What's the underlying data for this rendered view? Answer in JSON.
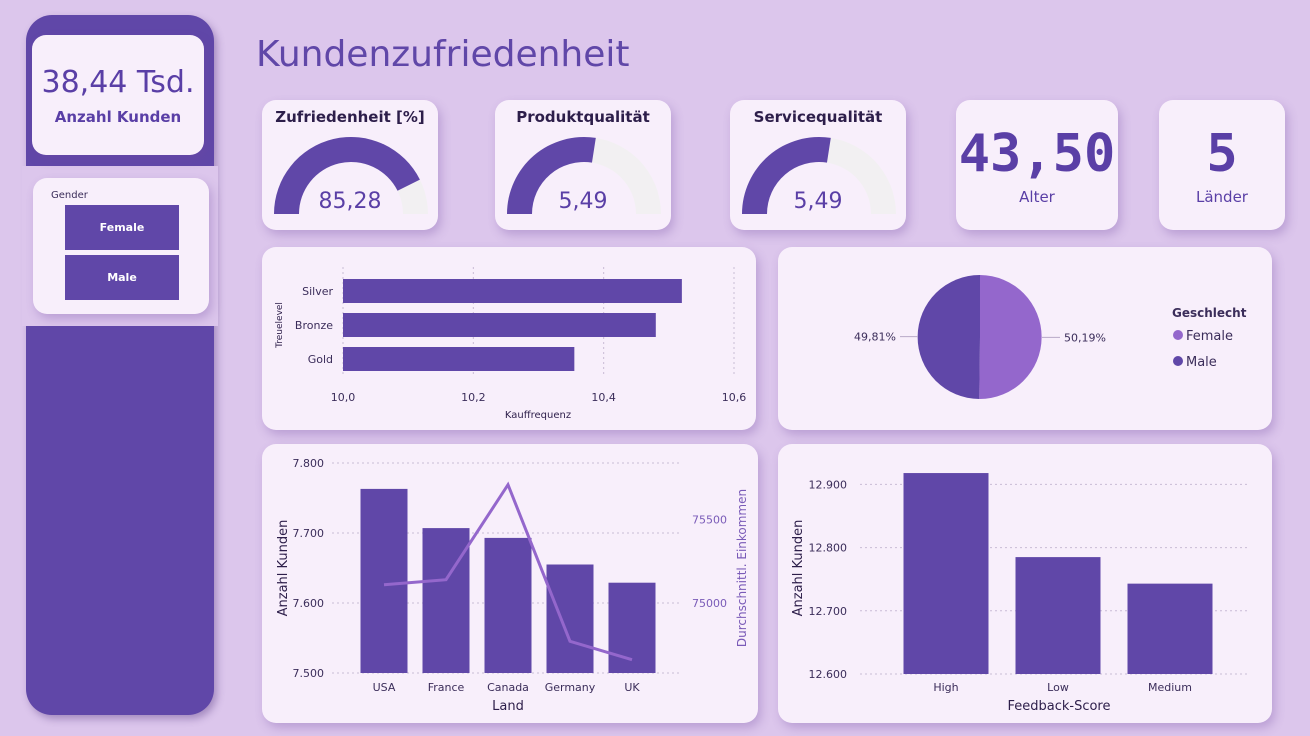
{
  "sidebar": {
    "kpi_value": "38,44 Tsd.",
    "kpi_label": "Anzahl Kunden",
    "slicer": {
      "title": "Gender",
      "options": [
        "Female",
        "Male"
      ]
    }
  },
  "page_title": "Kundenzufriedenheit",
  "gauges": [
    {
      "title": "Zufriedenheit [%]",
      "value_text": "85,28",
      "fraction": 0.8528
    },
    {
      "title": "Produktqualität",
      "value_text": "5,49",
      "fraction": 0.549
    },
    {
      "title": "Servicequalität",
      "value_text": "5,49",
      "fraction": 0.549
    }
  ],
  "stats": [
    {
      "value": "43,50",
      "label": "Alter"
    },
    {
      "value": "5",
      "label": "Länder"
    }
  ],
  "colors": {
    "primary": "#6047a8",
    "secondary": "#9467cc",
    "background": "#dcc6ec",
    "card": "#f8effb",
    "gauge_track": "#f2f0f2"
  },
  "chart_data": [
    {
      "type": "bar",
      "orientation": "horizontal",
      "categories": [
        "Silver",
        "Bronze",
        "Gold"
      ],
      "values": [
        10.52,
        10.48,
        10.355
      ],
      "xlabel": "Kauffrequenz",
      "ylabel": "Treuelevel",
      "xlim": [
        10.0,
        10.6
      ],
      "xticks": [
        "10,0",
        "10,2",
        "10,4",
        "10,6"
      ]
    },
    {
      "type": "pie",
      "legend_title": "Geschlecht",
      "categories": [
        "Female",
        "Male"
      ],
      "values": [
        50.19,
        49.81
      ],
      "labels": [
        "50,19%",
        "49,81%"
      ],
      "legend_position": "right"
    },
    {
      "type": "bar+line",
      "categories": [
        "USA",
        "France",
        "Canada",
        "Germany",
        "UK"
      ],
      "series": [
        {
          "name": "Anzahl Kunden",
          "type": "bar",
          "values": [
            7763,
            7707,
            7693,
            7655,
            7629
          ]
        },
        {
          "name": "Durchschnittl. Einkommen",
          "type": "line",
          "values": [
            75110,
            75140,
            75710,
            74770,
            74660
          ]
        }
      ],
      "xlabel": "Land",
      "ylabel": "Anzahl Kunden",
      "y2label": "Durchschnittl. Einkommen",
      "ylim": [
        7500,
        7800
      ],
      "yticks": [
        "7.500",
        "7.600",
        "7.700",
        "7.800"
      ],
      "y2ticks": [
        "75000",
        "75500"
      ],
      "y2lim": [
        74580,
        75840
      ]
    },
    {
      "type": "bar",
      "categories": [
        "High",
        "Low",
        "Medium"
      ],
      "values": [
        12918,
        12785,
        12743
      ],
      "xlabel": "Feedback-Score",
      "ylabel": "Anzahl Kunden",
      "ylim": [
        12600,
        12945
      ],
      "yticks": [
        "12.600",
        "12.700",
        "12.800",
        "12.900"
      ]
    }
  ]
}
